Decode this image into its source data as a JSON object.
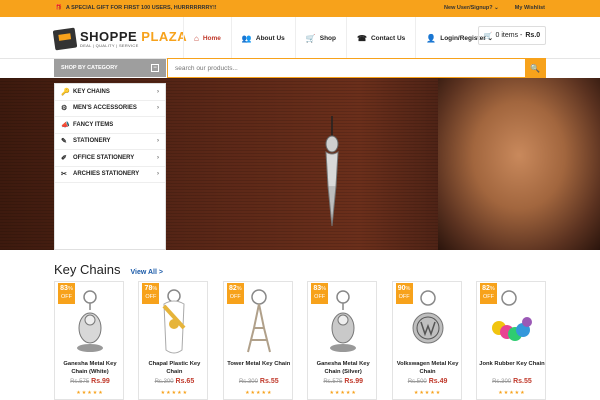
{
  "topbar": {
    "promo": "A SPECIAL GIFT FOR FIRST 100 USERS, HURRRRRRRY!!",
    "signup": "New User/Signup? ⌄",
    "wishlist": "My Wishlist"
  },
  "logo": {
    "name_a": "SHOPPE ",
    "name_b": "PLAZA",
    "tagline": "DEAL | QUALITY | SERVICE"
  },
  "nav": [
    {
      "label": "Home",
      "icon": "home-icon",
      "glyph": "⌂"
    },
    {
      "label": "About Us",
      "icon": "users-icon",
      "glyph": "👥"
    },
    {
      "label": "Shop",
      "icon": "cart-icon",
      "glyph": "🛒"
    },
    {
      "label": "Contact Us",
      "icon": "phone-icon",
      "glyph": "☎"
    },
    {
      "label": "Login/Register ⌄",
      "icon": "user-icon",
      "glyph": "👤"
    }
  ],
  "cart": {
    "label": "0 items - ",
    "total": "Rs.0"
  },
  "categories": {
    "header": "SHOP BY CATEGORY",
    "toggle": "−"
  },
  "search": {
    "placeholder": "search our products..."
  },
  "menu": [
    {
      "label": "KEY CHAINS",
      "glyph": "🔑",
      "icon": "key-icon",
      "sub": true
    },
    {
      "label": "MEN'S ACCESSORIES",
      "glyph": "⚙",
      "icon": "gear-icon",
      "sub": true
    },
    {
      "label": "FANCY ITEMS",
      "glyph": "📣",
      "icon": "megaphone-icon",
      "sub": false
    },
    {
      "label": "STATIONERY",
      "glyph": "✎",
      "icon": "pencil-icon",
      "sub": true
    },
    {
      "label": "OFFICE STATIONERY",
      "glyph": "✐",
      "icon": "edit-icon",
      "sub": true
    },
    {
      "label": "ARCHIES STATIONERY",
      "glyph": "✂",
      "icon": "scissors-icon",
      "sub": true
    }
  ],
  "section": {
    "title": "Key Chains",
    "view_all": "View All >"
  },
  "products": [
    {
      "discount": "83",
      "off": "OFF",
      "name": "Ganesha Metal Key Chain (White)",
      "old": "Rs.575",
      "price": "Rs.99",
      "stars": "★★★★★",
      "kind": "ganesha",
      "color": "#d8d8d8"
    },
    {
      "discount": "78",
      "off": "OFF",
      "name": "Chapal Plastic Key Chain",
      "old": "Rs.300",
      "price": "Rs.65",
      "stars": "★★★★★",
      "kind": "chapal",
      "color": "#e6b43a"
    },
    {
      "discount": "82",
      "off": "OFF",
      "name": "Tower Metal Key Chain",
      "old": "Rs.300",
      "price": "Rs.55",
      "stars": "★★★★★",
      "kind": "tower",
      "color": "#b0a08a"
    },
    {
      "discount": "83",
      "off": "OFF",
      "name": "Ganesha Metal Key Chain (Silver)",
      "old": "Rs.575",
      "price": "Rs.99",
      "stars": "★★★★★",
      "kind": "ganesha",
      "color": "#c9c9c9"
    },
    {
      "discount": "90",
      "off": "OFF",
      "name": "Volkswagen Metal Key Chain",
      "old": "Rs.500",
      "price": "Rs.49",
      "stars": "★★★★★",
      "kind": "vw",
      "color": "#bfbfbf"
    },
    {
      "discount": "82",
      "off": "OFF",
      "name": "Jonk Rubber Key Chain",
      "old": "Rs.300",
      "price": "Rs.55",
      "stars": "★★★★★",
      "kind": "jonk",
      "color": "#e84393"
    }
  ],
  "colors": {
    "accent": "#f7a21b",
    "price": "#c0392b",
    "link": "#1a5aa8"
  }
}
